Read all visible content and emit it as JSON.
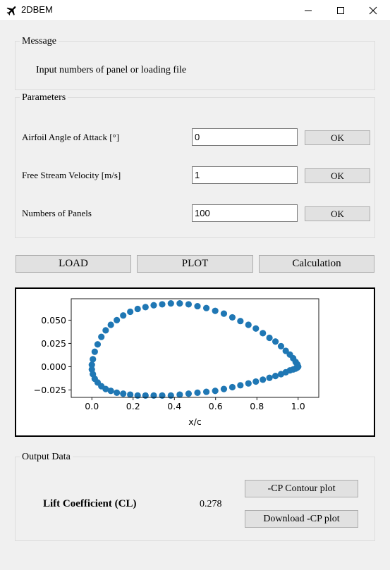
{
  "window": {
    "title": "2DBEM",
    "icon": "airplane-icon",
    "controls": [
      "minimize-icon",
      "maximize-icon",
      "close-icon"
    ]
  },
  "message_frame": {
    "title": "Message",
    "text": "Input numbers of panel or loading file"
  },
  "parameters": {
    "title": "Parameters",
    "rows": [
      {
        "label": "Airfoil Angle of Attack [°]",
        "value": "0",
        "button": "OK"
      },
      {
        "label": "Free Stream Velocity [m/s]",
        "value": "1",
        "button": "OK"
      },
      {
        "label": "Numbers of Panels",
        "value": "100",
        "button": "OK"
      }
    ]
  },
  "actions": {
    "load": "LOAD",
    "plot": "PLOT",
    "calculation": "Calculation"
  },
  "output": {
    "title": "Output Data",
    "cl_label": "Lift Coefficient (CL)",
    "cl_value": "0.278",
    "cp_contour_button": "-CP Contour plot",
    "download_cp_button": "Download -CP plot"
  },
  "chart_data": {
    "type": "scatter",
    "xlabel": "x/c",
    "ylabel": "",
    "xlim": [
      -0.1,
      1.1
    ],
    "ylim": [
      -0.033,
      0.073
    ],
    "xticks": [
      0.0,
      0.2,
      0.4,
      0.6,
      0.8,
      1.0
    ],
    "xtick_labels": [
      "0.0",
      "0.2",
      "0.4",
      "0.6",
      "0.8",
      "1.0"
    ],
    "yticks": [
      -0.025,
      0.0,
      0.025,
      0.05
    ],
    "ytick_labels": [
      "−0.025",
      "0.000",
      "0.025",
      "0.050"
    ],
    "marker_color": "#1f77b4",
    "grid": false,
    "series": [
      {
        "x": [
          1.0,
          0.996,
          0.988,
          0.976,
          0.96,
          0.94,
          0.917,
          0.89,
          0.861,
          0.829,
          0.795,
          0.759,
          0.72,
          0.681,
          0.64,
          0.598,
          0.555,
          0.512,
          0.469,
          0.426,
          0.383,
          0.341,
          0.3,
          0.26,
          0.222,
          0.186,
          0.152,
          0.121,
          0.092,
          0.067,
          0.046,
          0.028,
          0.014,
          0.005,
          0.0,
          0.0,
          0.005,
          0.014,
          0.028,
          0.046,
          0.067,
          0.092,
          0.121,
          0.152,
          0.186,
          0.222,
          0.26,
          0.3,
          0.341,
          0.383,
          0.426,
          0.469,
          0.512,
          0.555,
          0.598,
          0.64,
          0.681,
          0.72,
          0.759,
          0.795,
          0.829,
          0.861,
          0.89,
          0.917,
          0.94,
          0.96,
          0.976,
          0.988,
          0.996,
          1.0
        ],
        "y": [
          0.0,
          0.0025,
          0.005,
          0.009,
          0.013,
          0.017,
          0.022,
          0.027,
          0.031,
          0.036,
          0.041,
          0.045,
          0.049,
          0.053,
          0.057,
          0.06,
          0.063,
          0.065,
          0.067,
          0.068,
          0.068,
          0.067,
          0.066,
          0.064,
          0.062,
          0.059,
          0.055,
          0.05,
          0.045,
          0.039,
          0.032,
          0.024,
          0.016,
          0.008,
          0.002,
          -0.003,
          -0.008,
          -0.013,
          -0.017,
          -0.021,
          -0.024,
          -0.026,
          -0.028,
          -0.029,
          -0.03,
          -0.031,
          -0.031,
          -0.031,
          -0.031,
          -0.031,
          -0.03,
          -0.029,
          -0.028,
          -0.027,
          -0.026,
          -0.024,
          -0.022,
          -0.02,
          -0.018,
          -0.016,
          -0.014,
          -0.012,
          -0.01,
          -0.008,
          -0.006,
          -0.004,
          -0.003,
          -0.002,
          -0.001,
          0.0
        ]
      }
    ]
  }
}
